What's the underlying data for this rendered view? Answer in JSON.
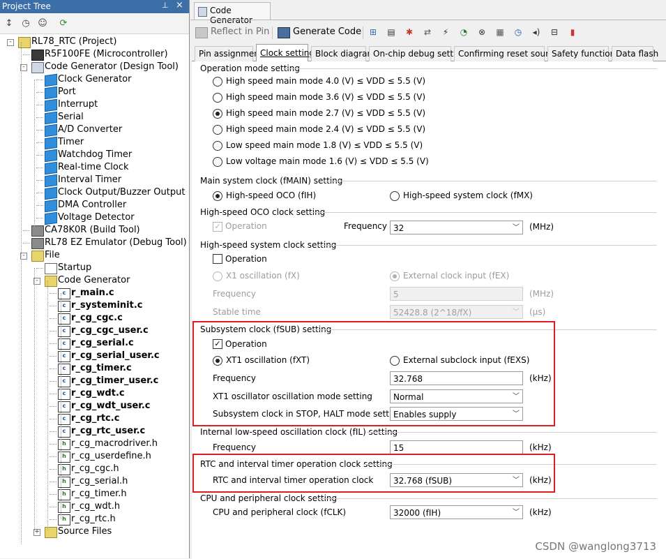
{
  "left_pane": {
    "title": "Project Tree",
    "pin_glyph": "⊥",
    "close_glyph": "×",
    "tree": [
      {
        "label": "RL78_RTC (Project)",
        "icon": "project-icon",
        "bold": false
      },
      {
        "label": "R5F100FE (Microcontroller)",
        "icon": "chip-icon",
        "bold": false
      },
      {
        "label": "Code Generator (Design Tool)",
        "icon": "code-generator-icon",
        "bold": false
      },
      {
        "label": "Clock Generator",
        "icon": "cube-icon",
        "bold": false
      },
      {
        "label": "Port",
        "icon": "cube-icon",
        "bold": false
      },
      {
        "label": "Interrupt",
        "icon": "cube-icon",
        "bold": false
      },
      {
        "label": "Serial",
        "icon": "cube-icon",
        "bold": false
      },
      {
        "label": "A/D Converter",
        "icon": "cube-icon",
        "bold": false
      },
      {
        "label": "Timer",
        "icon": "cube-icon",
        "bold": false
      },
      {
        "label": "Watchdog Timer",
        "icon": "cube-icon",
        "bold": false
      },
      {
        "label": "Real-time Clock",
        "icon": "cube-icon",
        "bold": false
      },
      {
        "label": "Interval Timer",
        "icon": "cube-icon",
        "bold": false
      },
      {
        "label": "Clock Output/Buzzer Output",
        "icon": "cube-icon",
        "bold": false
      },
      {
        "label": "DMA Controller",
        "icon": "cube-icon",
        "bold": false
      },
      {
        "label": "Voltage Detector",
        "icon": "cube-icon",
        "bold": false
      },
      {
        "label": "CA78K0R (Build Tool)",
        "icon": "hammer-icon",
        "bold": false
      },
      {
        "label": "RL78 EZ Emulator (Debug Tool)",
        "icon": "debugger-icon",
        "bold": false
      },
      {
        "label": "File",
        "icon": "folder-icon",
        "bold": false
      },
      {
        "label": "Startup",
        "icon": "startup-folder-icon",
        "bold": false
      },
      {
        "label": "Code Generator",
        "icon": "folder-icon",
        "bold": false
      },
      {
        "label": "r_main.c",
        "icon": "c-file-icon",
        "bold": true
      },
      {
        "label": "r_systeminit.c",
        "icon": "c-file-icon",
        "bold": true
      },
      {
        "label": "r_cg_cgc.c",
        "icon": "c-file-icon",
        "bold": true
      },
      {
        "label": "r_cg_cgc_user.c",
        "icon": "c-file-icon",
        "bold": true
      },
      {
        "label": "r_cg_serial.c",
        "icon": "c-file-icon",
        "bold": true
      },
      {
        "label": "r_cg_serial_user.c",
        "icon": "c-file-icon",
        "bold": true
      },
      {
        "label": "r_cg_timer.c",
        "icon": "c-file-icon",
        "bold": true
      },
      {
        "label": "r_cg_timer_user.c",
        "icon": "c-file-icon",
        "bold": true
      },
      {
        "label": "r_cg_wdt.c",
        "icon": "c-file-icon",
        "bold": true
      },
      {
        "label": "r_cg_wdt_user.c",
        "icon": "c-file-icon",
        "bold": true
      },
      {
        "label": "r_cg_rtc.c",
        "icon": "c-file-icon",
        "bold": true
      },
      {
        "label": "r_cg_rtc_user.c",
        "icon": "c-file-icon",
        "bold": true
      },
      {
        "label": "r_cg_macrodriver.h",
        "icon": "h-file-icon",
        "bold": false
      },
      {
        "label": "r_cg_userdefine.h",
        "icon": "h-file-icon",
        "bold": false
      },
      {
        "label": "r_cg_cgc.h",
        "icon": "h-file-icon",
        "bold": false
      },
      {
        "label": "r_cg_serial.h",
        "icon": "h-file-icon",
        "bold": false
      },
      {
        "label": "r_cg_timer.h",
        "icon": "h-file-icon",
        "bold": false
      },
      {
        "label": "r_cg_wdt.h",
        "icon": "h-file-icon",
        "bold": false
      },
      {
        "label": "r_cg_rtc.h",
        "icon": "h-file-icon",
        "bold": false
      },
      {
        "label": "Source Files",
        "icon": "folder-icon",
        "bold": false
      }
    ]
  },
  "document_tab": {
    "label": "Code Generator"
  },
  "toolbar": {
    "reflect_in_pin": "Reflect in Pin",
    "generate_code": "Generate Code"
  },
  "tabs": [
    {
      "label": "Pin assignment",
      "active": false
    },
    {
      "label": "Clock setting",
      "active": true
    },
    {
      "label": "Block diagram",
      "active": false
    },
    {
      "label": "On-chip debug setting",
      "active": false
    },
    {
      "label": "Confirming reset source",
      "active": false
    },
    {
      "label": "Safety functions",
      "active": false
    },
    {
      "label": "Data flash",
      "active": false
    }
  ],
  "operation_mode": {
    "header": "Operation mode setting",
    "options": [
      {
        "label": "High speed main mode 4.0 (V) ≤ VDD ≤ 5.5 (V)",
        "selected": false
      },
      {
        "label": "High speed main mode 3.6 (V) ≤ VDD ≤ 5.5 (V)",
        "selected": false
      },
      {
        "label": "High speed main mode 2.7 (V) ≤ VDD ≤ 5.5 (V)",
        "selected": true
      },
      {
        "label": "High speed main mode 2.4 (V) ≤ VDD ≤ 5.5 (V)",
        "selected": false
      },
      {
        "label": "Low speed main mode 1.8 (V) ≤ VDD ≤ 5.5 (V)",
        "selected": false
      },
      {
        "label": "Low voltage main mode 1.6 (V) ≤ VDD ≤ 5.5 (V)",
        "selected": false
      }
    ]
  },
  "main_clock": {
    "header": "Main system clock (fMAIN) setting",
    "option_oco": "High-speed OCO (fIH)",
    "option_mx": "High-speed system clock (fMX)"
  },
  "oco": {
    "header": "High-speed OCO clock setting",
    "operation_label": "Operation",
    "frequency_label": "Frequency",
    "frequency_value": "32",
    "unit": "(MHz)"
  },
  "hs_system": {
    "header": "High-speed system clock setting",
    "operation_label": "Operation",
    "x1_label": "X1 oscillation (fX)",
    "ext_label": "External clock input (fEX)",
    "frequency_label": "Frequency",
    "frequency_value": "5",
    "frequency_unit": "(MHz)",
    "stable_label": "Stable time",
    "stable_value": "52428.8 (2^18/fX)",
    "stable_unit": "(μs)"
  },
  "subsystem": {
    "header": "Subsystem clock (fSUB) setting",
    "operation_label": "Operation",
    "xt1_label": "XT1 oscillation (fXT)",
    "exs_label": "External subclock input (fEXS)",
    "frequency_label": "Frequency",
    "frequency_value": "32.768",
    "frequency_unit": "(kHz)",
    "mode_label": "XT1 oscillator oscillation mode setting",
    "mode_value": "Normal",
    "stop_label": "Subsystem clock in STOP, HALT mode setting",
    "stop_value": "Enables supply"
  },
  "low_speed": {
    "header": "Internal low-speed oscillation clock (fIL) setting",
    "frequency_label": "Frequency",
    "frequency_value": "15",
    "unit": "(kHz)"
  },
  "rtc_clock": {
    "header": "RTC and interval timer operation clock setting",
    "label": "RTC and interval timer operation clock",
    "value": "32.768 (fSUB)",
    "unit": "(kHz)"
  },
  "cpu_clock": {
    "header": "CPU and peripheral clock setting",
    "label": "CPU and peripheral clock (fCLK)",
    "value": "32000 (fIH)",
    "unit": "(kHz)"
  },
  "watermark": "CSDN @wanglong3713",
  "colors": {
    "highlight_box": "#e01c1c",
    "title_bar": "#3c6ea8"
  }
}
